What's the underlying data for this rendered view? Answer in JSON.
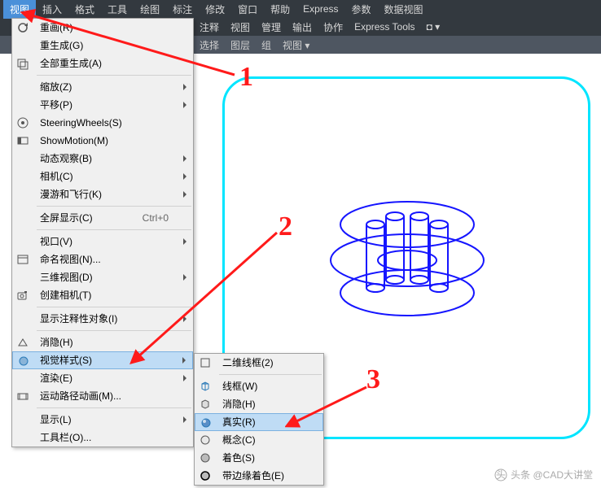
{
  "menubar": {
    "items": [
      "视图",
      "插入",
      "格式",
      "工具",
      "绘图",
      "标注",
      "修改",
      "窗口",
      "帮助",
      "Express",
      "参数",
      "数据视图"
    ],
    "selected_index": 0
  },
  "ribbon_top": {
    "items": [
      "注释",
      "视图",
      "管理",
      "输出",
      "协作",
      "Express Tools",
      "◘ ▾"
    ]
  },
  "ribbon_bottom": {
    "items": [
      "选择",
      "图层",
      "组",
      "视图 ▾"
    ]
  },
  "menu1": {
    "groups": [
      [
        {
          "label": "重画(R)",
          "icon": "redraw"
        },
        {
          "label": "重生成(G)"
        },
        {
          "label": "全部重生成(A)",
          "icon": "regenall"
        }
      ],
      [
        {
          "label": "缩放(Z)",
          "sub": true
        },
        {
          "label": "平移(P)",
          "sub": true
        },
        {
          "label": "SteeringWheels(S)",
          "icon": "wheel"
        },
        {
          "label": "ShowMotion(M)",
          "icon": "motion"
        },
        {
          "label": "动态观察(B)",
          "sub": true
        },
        {
          "label": "相机(C)",
          "sub": true
        },
        {
          "label": "漫游和飞行(K)",
          "sub": true
        }
      ],
      [
        {
          "label": "全屏显示(C)",
          "hotkey": "Ctrl+0"
        }
      ],
      [
        {
          "label": "视口(V)",
          "sub": true
        },
        {
          "label": "命名视图(N)...",
          "icon": "named"
        },
        {
          "label": "三维视图(D)",
          "sub": true
        },
        {
          "label": "创建相机(T)",
          "icon": "camera"
        }
      ],
      [
        {
          "label": "显示注释性对象(I)",
          "sub": true
        }
      ],
      [
        {
          "label": "消隐(H)",
          "icon": "hide"
        },
        {
          "label": "视觉样式(S)",
          "sub": true,
          "hl": true,
          "icon": "vstyle"
        },
        {
          "label": "渲染(E)",
          "sub": true
        },
        {
          "label": "运动路径动画(M)...",
          "icon": "anim"
        }
      ],
      [
        {
          "label": "显示(L)",
          "sub": true
        },
        {
          "label": "工具栏(O)..."
        }
      ]
    ]
  },
  "menu2": {
    "items": [
      {
        "label": "二维线框(2)",
        "icon": "wf2d"
      },
      {
        "sep": true
      },
      {
        "label": "线框(W)",
        "icon": "wf"
      },
      {
        "label": "消隐(H)",
        "icon": "hide2"
      },
      {
        "label": "真实(R)",
        "icon": "real",
        "hl": true
      },
      {
        "label": "概念(C)",
        "icon": "concept"
      },
      {
        "label": "着色(S)",
        "icon": "shade"
      },
      {
        "label": "带边缘着色(E)",
        "icon": "shadee"
      }
    ]
  },
  "annotations": {
    "n1": "1",
    "n2": "2",
    "n3": "3"
  },
  "watermark": "头条 @CAD大讲堂"
}
